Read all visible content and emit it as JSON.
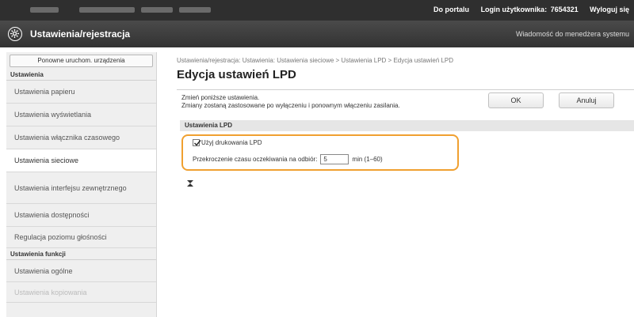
{
  "topbar": {
    "portal_link": "Do portalu",
    "login_label": "Login użytkownika:",
    "login_id": "7654321",
    "logout": "Wyloguj się"
  },
  "header": {
    "title": "Ustawienia/rejestracja",
    "system_message": "Wiadomość do menedżera systemu"
  },
  "sidebar": {
    "restart_button": "Ponowne uruchom. urządzenia",
    "settings_heading": "Ustawienia",
    "items": [
      {
        "label": "Ustawienia papieru"
      },
      {
        "label": "Ustawienia wyświetlania"
      },
      {
        "label": "Ustawienia włącznika czasowego"
      },
      {
        "label": "Ustawienia sieciowe"
      },
      {
        "label": "Ustawienia interfejsu zewnętrznego"
      },
      {
        "label": "Ustawienia dostępności"
      },
      {
        "label": "Regulacja poziomu głośności"
      }
    ],
    "functions_heading": "Ustawienia funkcji",
    "function_items": [
      {
        "label": "Ustawienia ogólne"
      },
      {
        "label": "Ustawienia kopiowania"
      }
    ]
  },
  "main": {
    "breadcrumb": "Ustawienia/rejestracja: Ustawienia: Ustawienia sieciowe > Ustawienia LPD > Edycja ustawień LPD",
    "title": "Edycja ustawień LPD",
    "description_line1": "Zmień poniższe ustawienia.",
    "description_line2": "Zmiany zostaną zastosowane po wyłączeniu i ponownym włączeniu zasilania.",
    "ok_button": "OK",
    "cancel_button": "Anuluj",
    "group_title": "Ustawienia LPD",
    "use_lpd_label": "Użyj drukowania LPD",
    "use_lpd_checked": true,
    "timeout_label": "Przekroczenie czasu oczekiwania na odbiór:",
    "timeout_value": "5",
    "timeout_unit": "min (1–60)"
  }
}
